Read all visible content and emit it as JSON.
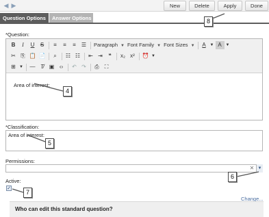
{
  "toolbar": {
    "nav_prev_icon": "arrow-left-icon",
    "nav_next_icon": "arrow-right-icon",
    "new_label": "New",
    "delete_label": "Delete",
    "apply_label": "Apply",
    "done_label": "Done"
  },
  "tabs": [
    {
      "label": "Question Options",
      "active": true
    },
    {
      "label": "Answer Options",
      "active": false
    }
  ],
  "question": {
    "label": "*Question:",
    "editor_text": "Area of interest:",
    "paragraph_label": "Paragraph",
    "font_family_label": "Font Family",
    "font_sizes_label": "Font Sizes"
  },
  "classification": {
    "label": "*Classification:",
    "value": "Area of interest:"
  },
  "permissions": {
    "label": "Permissions:",
    "value": ""
  },
  "active": {
    "label": "Active:",
    "checked": true
  },
  "change_link": "Change...",
  "panel": {
    "title": "Who can edit this standard question?"
  },
  "callouts": [
    "4",
    "5",
    "6",
    "7",
    "8"
  ],
  "colors": {
    "tab_active": "#5d5d5d",
    "tab_inactive": "#b4b4b4",
    "link": "#4a6ea0"
  }
}
